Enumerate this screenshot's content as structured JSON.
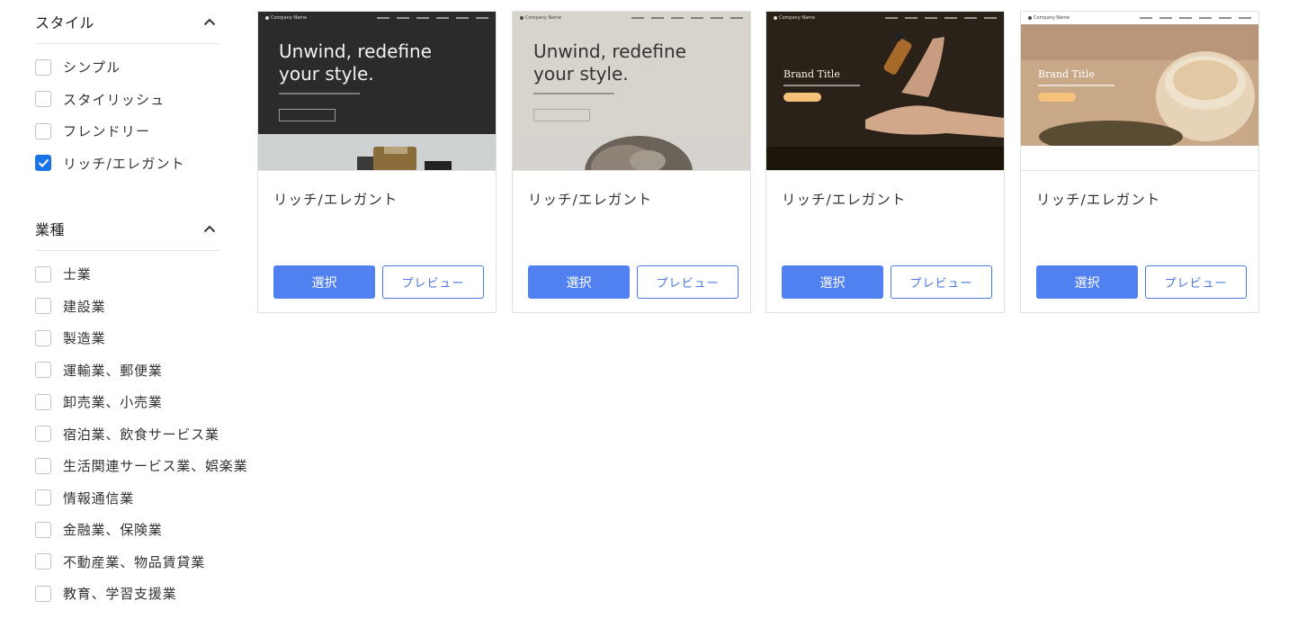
{
  "sidebar": {
    "style_section": {
      "title": "スタイル",
      "options": [
        {
          "label": "シンプル",
          "checked": false
        },
        {
          "label": "スタイリッシュ",
          "checked": false
        },
        {
          "label": "フレンドリー",
          "checked": false
        },
        {
          "label": "リッチ/エレガント",
          "checked": true
        }
      ]
    },
    "industry_section": {
      "title": "業種",
      "options": [
        {
          "label": "士業",
          "checked": false
        },
        {
          "label": "建設業",
          "checked": false
        },
        {
          "label": "製造業",
          "checked": false
        },
        {
          "label": "運輸業、郵便業",
          "checked": false
        },
        {
          "label": "卸売業、小売業",
          "checked": false
        },
        {
          "label": "宿泊業、飲食サービス業",
          "checked": false
        },
        {
          "label": "生活関連サービス業、娯楽業",
          "checked": false
        },
        {
          "label": "情報通信業",
          "checked": false
        },
        {
          "label": "金融業、保険業",
          "checked": false
        },
        {
          "label": "不動産業、物品賃貸業",
          "checked": false
        },
        {
          "label": "教育、学習支援業",
          "checked": false
        }
      ]
    }
  },
  "cards": [
    {
      "title": "リッチ/エレガント",
      "select_label": "選択",
      "preview_label": "プレビュー",
      "thumb": {
        "logo": "Company Name",
        "hero_line1": "Unwind, redefine",
        "hero_line2": "your style."
      }
    },
    {
      "title": "リッチ/エレガント",
      "select_label": "選択",
      "preview_label": "プレビュー",
      "thumb": {
        "logo": "Company Name",
        "hero_line1": "Unwind, redefine",
        "hero_line2": "your style."
      }
    },
    {
      "title": "リッチ/エレガント",
      "select_label": "選択",
      "preview_label": "プレビュー",
      "thumb": {
        "logo": "Company Name",
        "brand_title": "Brand Title"
      }
    },
    {
      "title": "リッチ/エレガント",
      "select_label": "選択",
      "preview_label": "プレビュー",
      "thumb": {
        "logo": "Company Name",
        "brand_title": "Brand Title"
      }
    }
  ],
  "colors": {
    "accent": "#5181f0",
    "checkbox_checked": "#1a73e8",
    "border": "#e0e0e0"
  },
  "icons": {
    "section_toggle": "chevron-up-icon",
    "checkbox_mark": "checkmark-icon"
  }
}
